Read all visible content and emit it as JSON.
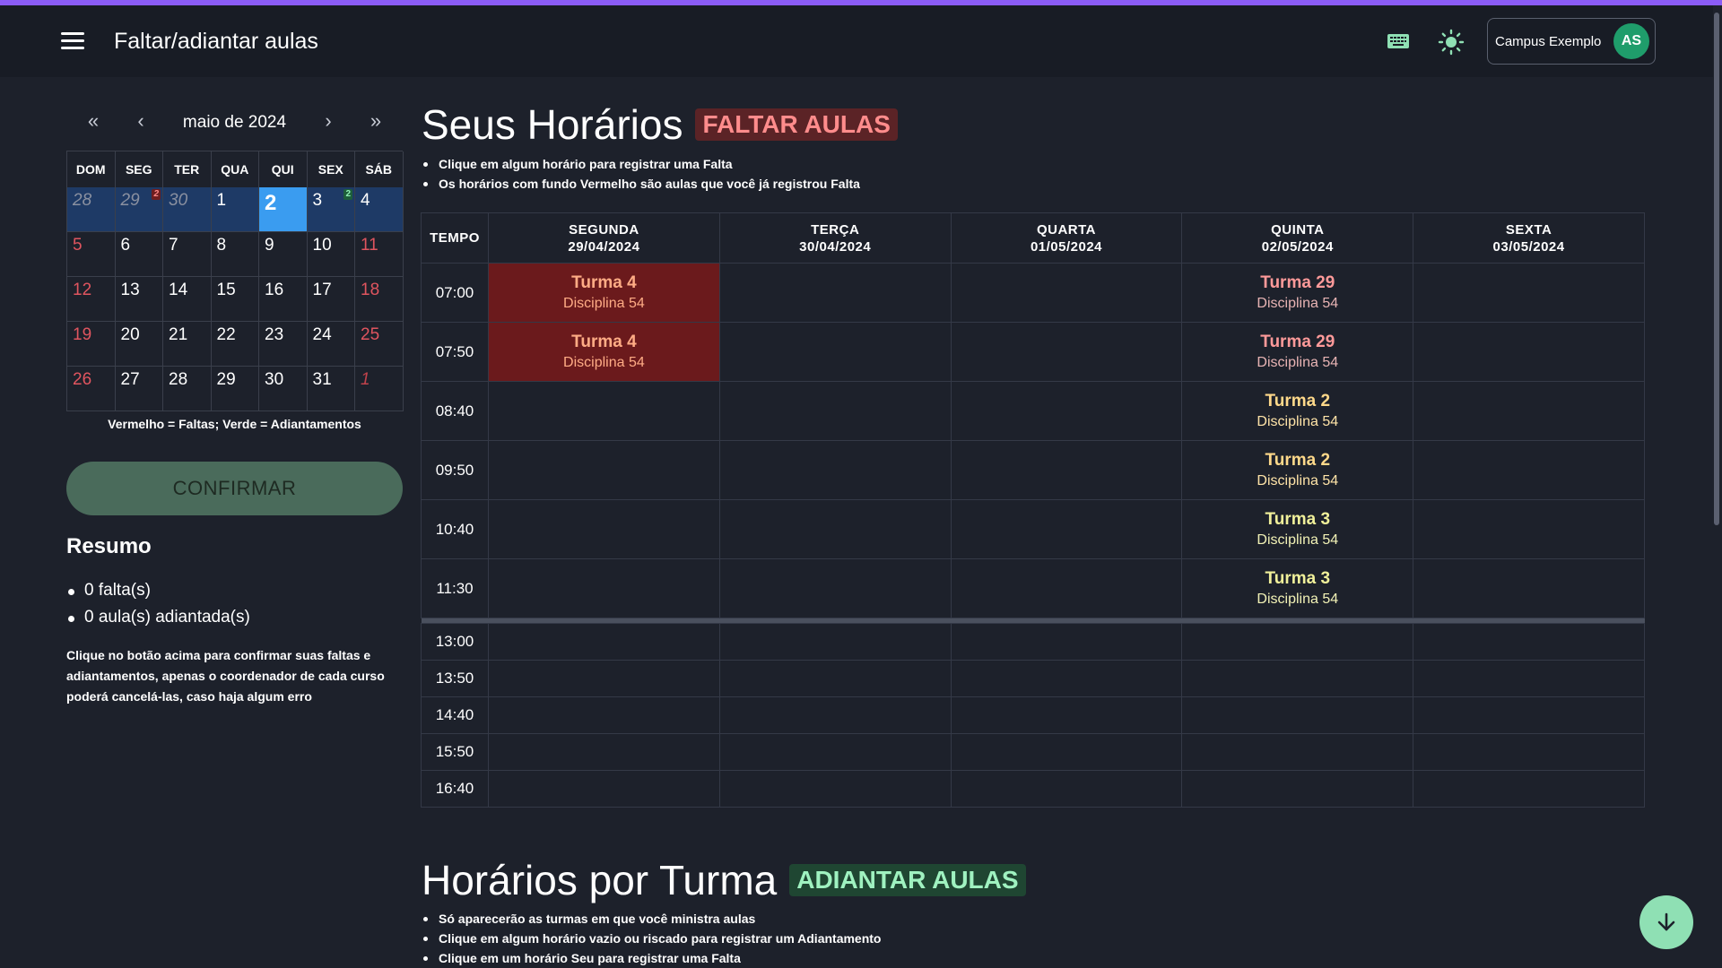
{
  "header": {
    "title": "Faltar/adiantar aulas",
    "campus": "Campus Exemplo",
    "avatar_initials": "AS"
  },
  "calendar": {
    "month_label": "maio de 2024",
    "weekdays": [
      "DOM",
      "SEG",
      "TER",
      "QUA",
      "QUI",
      "SEX",
      "SÁB"
    ],
    "weeks": [
      [
        "28",
        "29",
        "30",
        "1",
        "2",
        "3",
        "4"
      ],
      [
        "5",
        "6",
        "7",
        "8",
        "9",
        "10",
        "11"
      ],
      [
        "12",
        "13",
        "14",
        "15",
        "16",
        "17",
        "18"
      ],
      [
        "19",
        "20",
        "21",
        "22",
        "23",
        "24",
        "25"
      ],
      [
        "26",
        "27",
        "28",
        "29",
        "30",
        "31",
        "1"
      ]
    ],
    "badge_faltas": "2",
    "badge_adiantamentos": "2",
    "legend": "Vermelho = Faltas; Verde = Adiantamentos"
  },
  "confirm_label": "CONFIRMAR",
  "resumo": {
    "title": "Resumo",
    "items": [
      "0 falta(s)",
      "0 aula(s) adiantada(s)"
    ],
    "note": "Clique no botão acima para confirmar suas faltas e adiantamentos, apenas o coordenador de cada curso poderá cancelá-las, caso haja algum erro"
  },
  "horarios": {
    "title": "Seus Horários",
    "badge": "FALTAR AULAS",
    "bullets": [
      "Clique em algum horário para registrar uma Falta",
      "Os horários com fundo Vermelho são aulas que você já registrou Falta"
    ],
    "time_header": "TEMPO",
    "days": [
      {
        "name": "SEGUNDA",
        "date": "29/04/2024"
      },
      {
        "name": "TERÇA",
        "date": "30/04/2024"
      },
      {
        "name": "QUARTA",
        "date": "01/05/2024"
      },
      {
        "name": "QUINTA",
        "date": "02/05/2024"
      },
      {
        "name": "SEXTA",
        "date": "03/05/2024"
      }
    ],
    "morning_times": [
      "07:00",
      "07:50",
      "08:40",
      "09:50",
      "10:40",
      "11:30"
    ],
    "afternoon_times": [
      "13:00",
      "13:50",
      "14:40",
      "15:50",
      "16:40"
    ],
    "classes": {
      "seg_0700": {
        "turma": "Turma 4",
        "disciplina": "Disciplina 54"
      },
      "seg_0750": {
        "turma": "Turma 4",
        "disciplina": "Disciplina 54"
      },
      "qui_0700": {
        "turma": "Turma 29",
        "disciplina": "Disciplina 54"
      },
      "qui_0750": {
        "turma": "Turma 29",
        "disciplina": "Disciplina 54"
      },
      "qui_0840": {
        "turma": "Turma 2",
        "disciplina": "Disciplina 54"
      },
      "qui_0950": {
        "turma": "Turma 2",
        "disciplina": "Disciplina 54"
      },
      "qui_1040": {
        "turma": "Turma 3",
        "disciplina": "Disciplina 54"
      },
      "qui_1130": {
        "turma": "Turma 3",
        "disciplina": "Disciplina 54"
      }
    }
  },
  "por_turma": {
    "title": "Horários por Turma",
    "badge": "ADIANTAR AULAS",
    "bullets": [
      "Só aparecerão as turmas em que você ministra aulas",
      "Clique em algum horário vazio ou riscado para registrar um Adiantamento",
      "Clique em um horário Seu para registrar uma Falta"
    ]
  },
  "colors": {
    "accent_stripe": "#8b5cf6",
    "falta_bg": "#6b1a1c",
    "selected_day": "#3a9cf0",
    "fab": "#8fe0b4"
  }
}
